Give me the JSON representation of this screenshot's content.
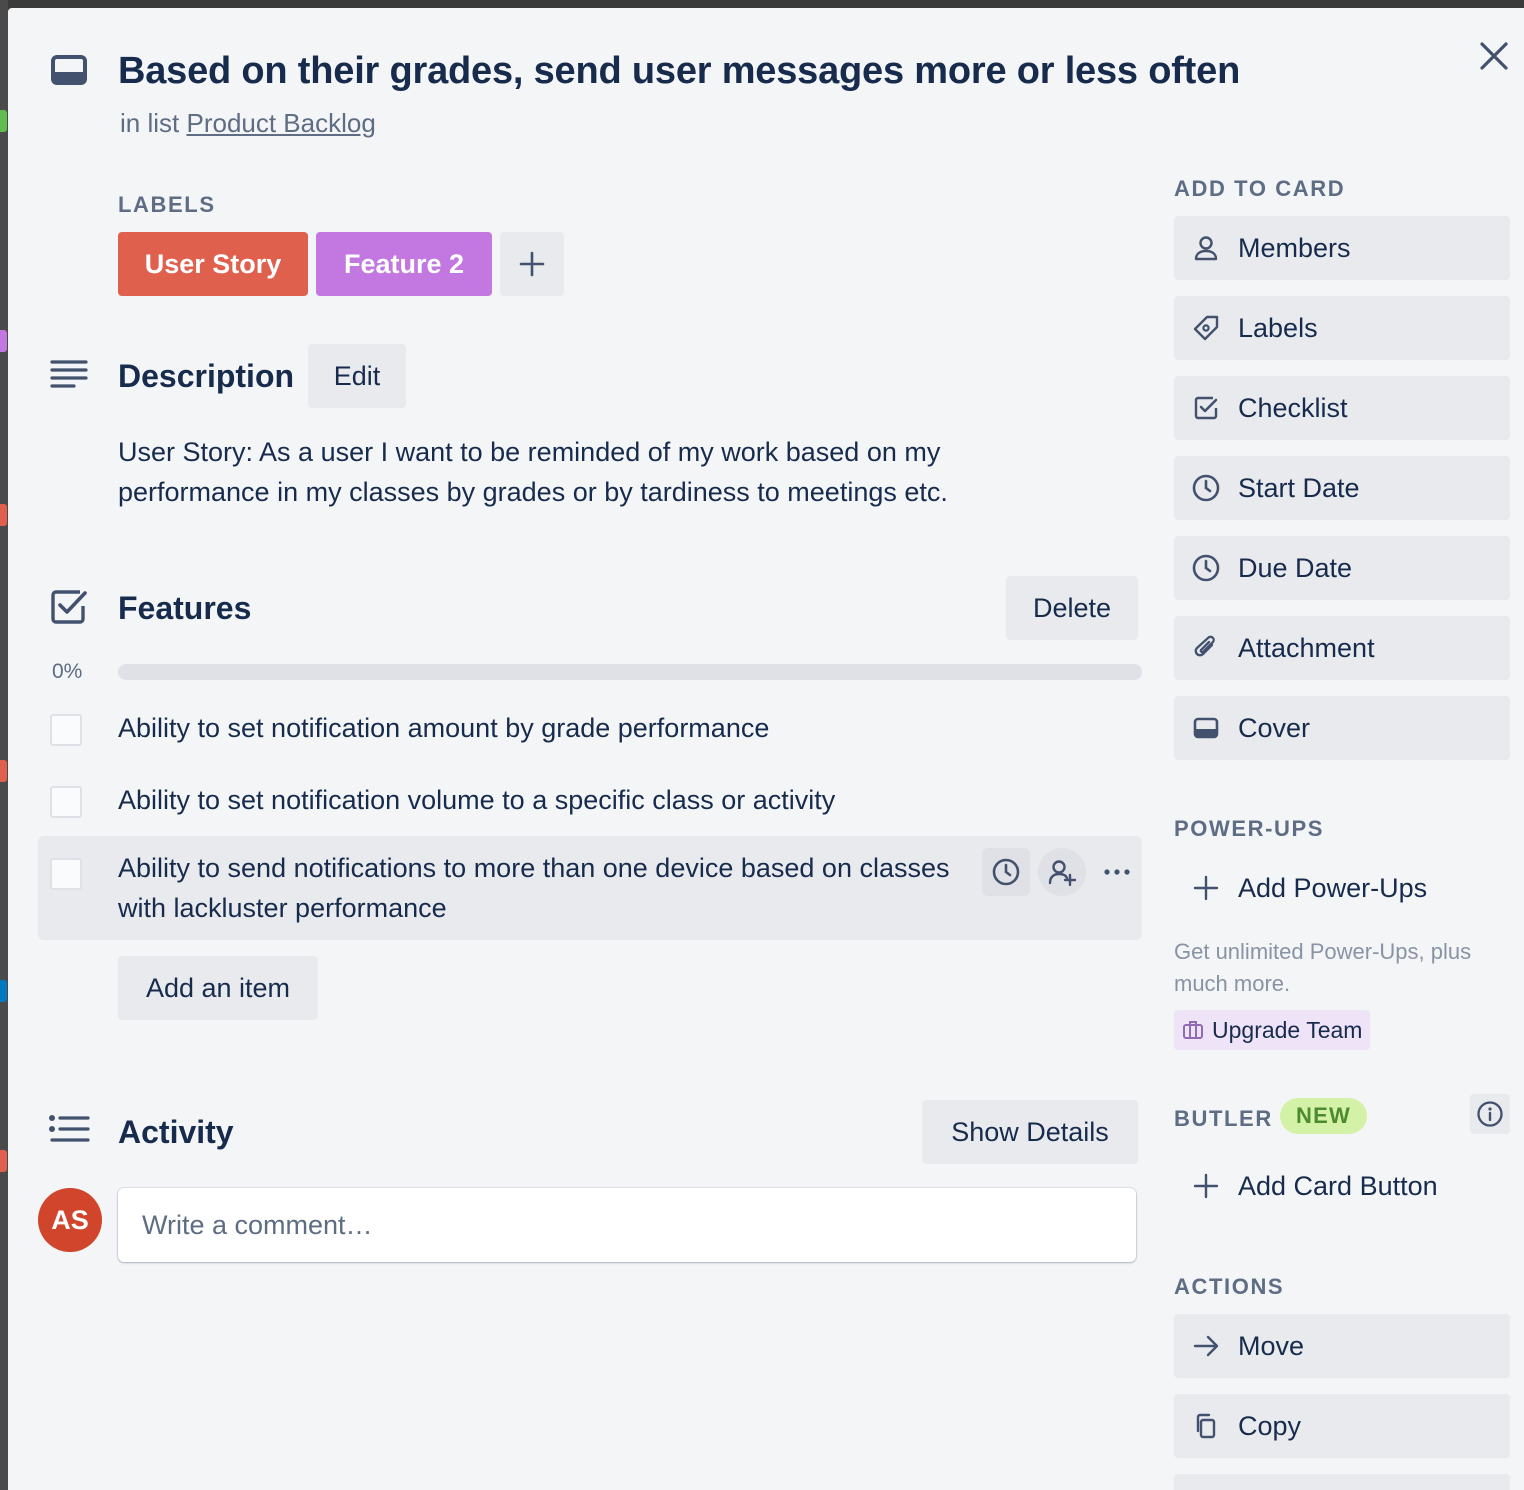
{
  "card": {
    "title": "Based on their grades, send user messages more or less often",
    "in_list_prefix": "in list",
    "list_name": "Product Backlog"
  },
  "labels": {
    "heading": "LABELS",
    "items": [
      {
        "text": "User Story",
        "color": "#e0604e"
      },
      {
        "text": "Feature 2",
        "color": "#c377e0"
      }
    ]
  },
  "description": {
    "heading": "Description",
    "edit_label": "Edit",
    "text": "User Story: As a user I want to be reminded of my work based on my performance in my classes by grades or by tardiness to meetings etc."
  },
  "checklist": {
    "heading": "Features",
    "delete_label": "Delete",
    "progress_text": "0%",
    "progress": 0,
    "items": [
      {
        "text": "Ability to set notification amount by grade performance",
        "checked": false
      },
      {
        "text": "Ability to set notification volume to a specific class or activity",
        "checked": false
      },
      {
        "text": "Ability to send notifications to more than one device based on classes with lackluster performance",
        "checked": false
      }
    ],
    "add_item_label": "Add an item"
  },
  "activity": {
    "heading": "Activity",
    "show_details_label": "Show Details",
    "comment_placeholder": "Write a comment…",
    "avatar_initials": "AS"
  },
  "sidebar": {
    "add_to_card_heading": "ADD TO CARD",
    "add_to_card": [
      {
        "label": "Members",
        "icon": "person-icon"
      },
      {
        "label": "Labels",
        "icon": "tag-icon"
      },
      {
        "label": "Checklist",
        "icon": "checkbox-icon"
      },
      {
        "label": "Start Date",
        "icon": "clock-icon"
      },
      {
        "label": "Due Date",
        "icon": "clock-icon"
      },
      {
        "label": "Attachment",
        "icon": "paperclip-icon"
      },
      {
        "label": "Cover",
        "icon": "card-cover-icon"
      }
    ],
    "power_ups_heading": "POWER-UPS",
    "add_power_ups_label": "Add Power-Ups",
    "promo_text": "Get unlimited Power-Ups, plus much more.",
    "upgrade_label": "Upgrade Team",
    "butler_heading": "BUTLER",
    "butler_badge": "NEW",
    "add_card_button_label": "Add Card Button",
    "actions_heading": "ACTIONS",
    "actions": [
      {
        "label": "Move",
        "icon": "arrow-right-icon"
      },
      {
        "label": "Copy",
        "icon": "copy-icon"
      }
    ]
  },
  "colors": {
    "text": "#172b4d",
    "subtle": "#5e6c84",
    "button_bg": "#e9eaee",
    "modal_bg": "#f4f5f7"
  }
}
